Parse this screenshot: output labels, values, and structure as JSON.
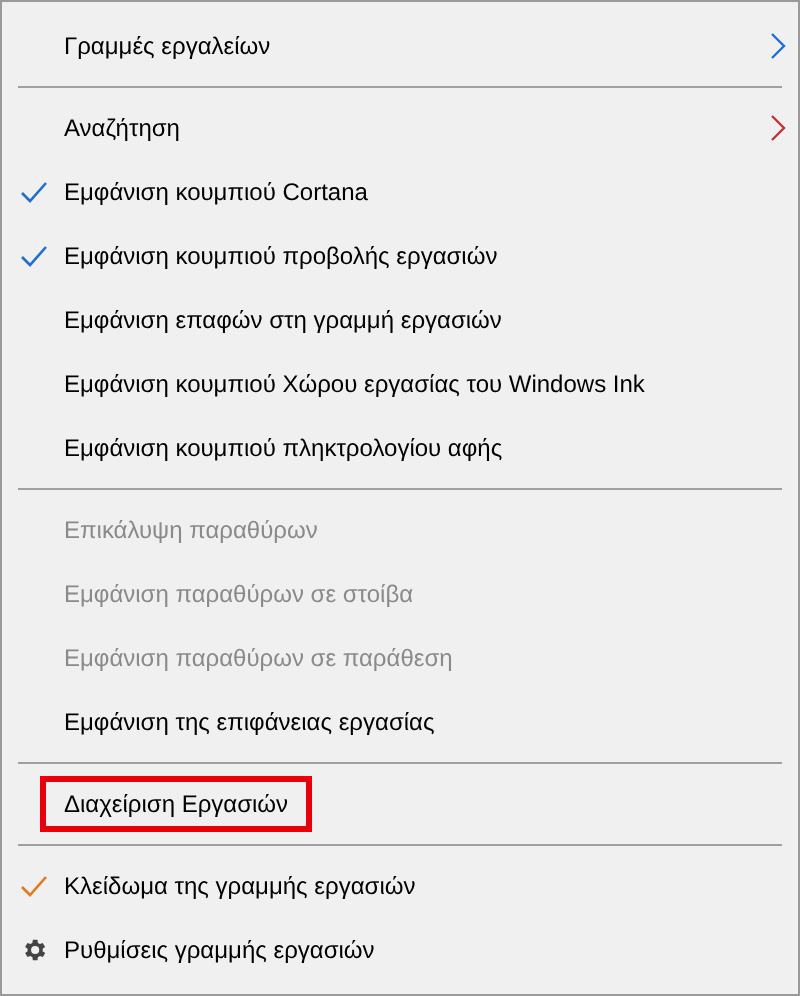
{
  "menu": {
    "items": [
      {
        "kind": "item",
        "label": "Γραμμές εργαλείων",
        "submenu": true,
        "color": "#1e6fd0",
        "disabled": false
      },
      {
        "kind": "separator"
      },
      {
        "kind": "item",
        "label": "Αναζήτηση",
        "submenu": true,
        "color": "#c0303a",
        "disabled": false
      },
      {
        "kind": "item",
        "label": "Εμφάνιση κουμπιού Cortana",
        "checked": true,
        "color": "#1e6fd0",
        "disabled": false
      },
      {
        "kind": "item",
        "label": "Εμφάνιση κουμπιού προβολής εργασιών",
        "checked": true,
        "color": "#1e6fd0",
        "disabled": false
      },
      {
        "kind": "item",
        "label": "Εμφάνιση επαφών στη γραμμή εργασιών",
        "checked": false,
        "disabled": false
      },
      {
        "kind": "item",
        "label": "Εμφάνιση κουμπιού Χώρου εργασίας του Windows Ink",
        "checked": false,
        "disabled": false
      },
      {
        "kind": "item",
        "label": "Εμφάνιση κουμπιού πληκτρολογίου αφής",
        "checked": false,
        "disabled": false
      },
      {
        "kind": "separator"
      },
      {
        "kind": "item",
        "label": "Επικάλυψη παραθύρων",
        "disabled": true
      },
      {
        "kind": "item",
        "label": "Εμφάνιση παραθύρων σε στοίβα",
        "disabled": true
      },
      {
        "kind": "item",
        "label": "Εμφάνιση παραθύρων σε παράθεση",
        "disabled": true
      },
      {
        "kind": "item",
        "label": "Εμφάνιση της επιφάνειας εργασίας",
        "disabled": false
      },
      {
        "kind": "separator"
      },
      {
        "kind": "item",
        "label": "Διαχείριση Εργασιών",
        "disabled": false,
        "highlighted": true
      },
      {
        "kind": "separator"
      },
      {
        "kind": "item",
        "label": "Κλείδωμα της γραμμής εργασιών",
        "checked": true,
        "color": "#e07a1c",
        "disabled": false
      },
      {
        "kind": "settings",
        "label": "Ρυθμίσεις γραμμής εργασιών",
        "disabled": false
      }
    ]
  }
}
